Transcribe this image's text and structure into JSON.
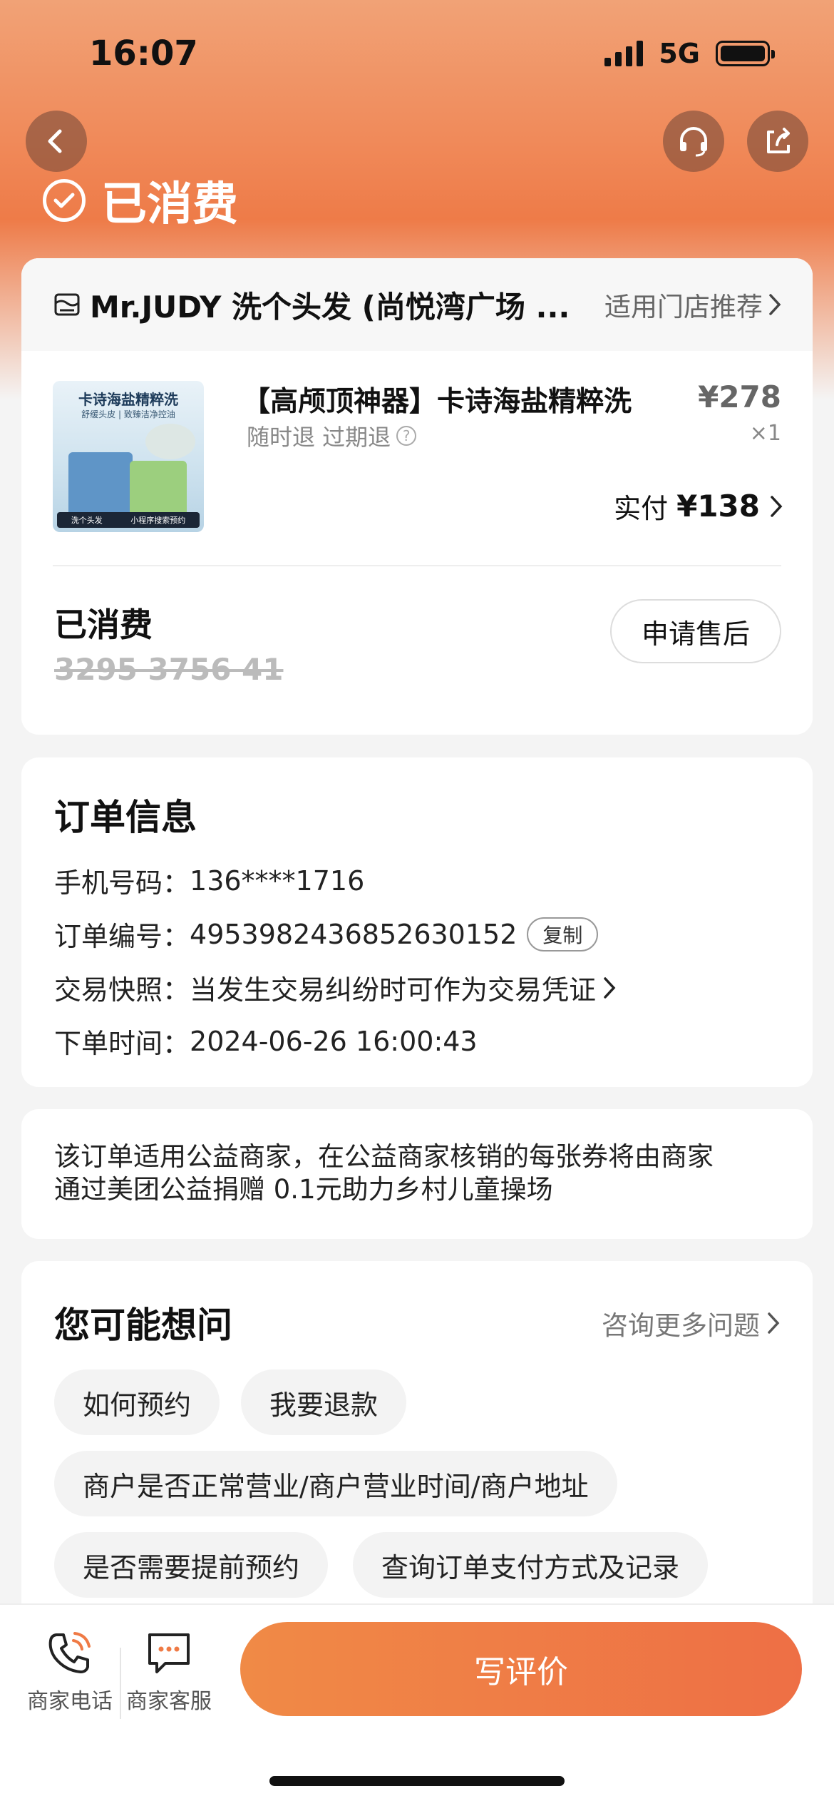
{
  "status_bar": {
    "time": "16:07",
    "network": "5G"
  },
  "header": {
    "status_title": "已消费"
  },
  "store": {
    "name": "Mr.JUDY 洗个头发 (尚悦湾广场 ...",
    "link": "适用门店推荐"
  },
  "product": {
    "thumb_title": "卡诗海盐精粹洗",
    "thumb_sub": "舒缓头皮 | 致臻洁净控油",
    "thumb_bar_left": "洗个头发",
    "thumb_bar_right": "小程序搜索预约",
    "title": "【高颅顶神器】卡诗海盐精粹洗",
    "tags": "随时退 过期退",
    "price": "¥278",
    "qty": "×1",
    "paid_label": "实付",
    "paid_value": "¥138"
  },
  "consumed": {
    "title": "已消费",
    "code": "3295 3756 41",
    "after_sale": "申请售后"
  },
  "order": {
    "title": "订单信息",
    "phone_label": "手机号码：",
    "phone": "136****1716",
    "order_no_label": "订单编号：",
    "order_no": "4953982436852630152",
    "copy": "复制",
    "snapshot_label": "交易快照：",
    "snapshot": "当发生交易纠纷时可作为交易凭证",
    "time_label": "下单时间：",
    "time": "2024-06-26 16:00:43"
  },
  "charity": {
    "line1": "该订单适用公益商家，在公益商家核销的每张券将由商家",
    "line2": "通过美团公益捐赠 0.1元助力乡村儿童操场"
  },
  "faq": {
    "title": "您可能想问",
    "more": "咨询更多问题",
    "chips": [
      "如何预约",
      "我要退款",
      "商户是否正常营业/商户营业时间/商户地址",
      "是否需要提前预约",
      "查询订单支付方式及记录"
    ]
  },
  "bottom": {
    "phone": "商家电话",
    "service": "商家客服",
    "review": "写评价"
  },
  "colors": {
    "accent": "#ee7b48",
    "button": "#ef7a45"
  },
  "icons": [
    "back-icon",
    "headset-icon",
    "share-icon",
    "check-circle-icon",
    "store-icon",
    "phone-icon",
    "chat-icon"
  ]
}
